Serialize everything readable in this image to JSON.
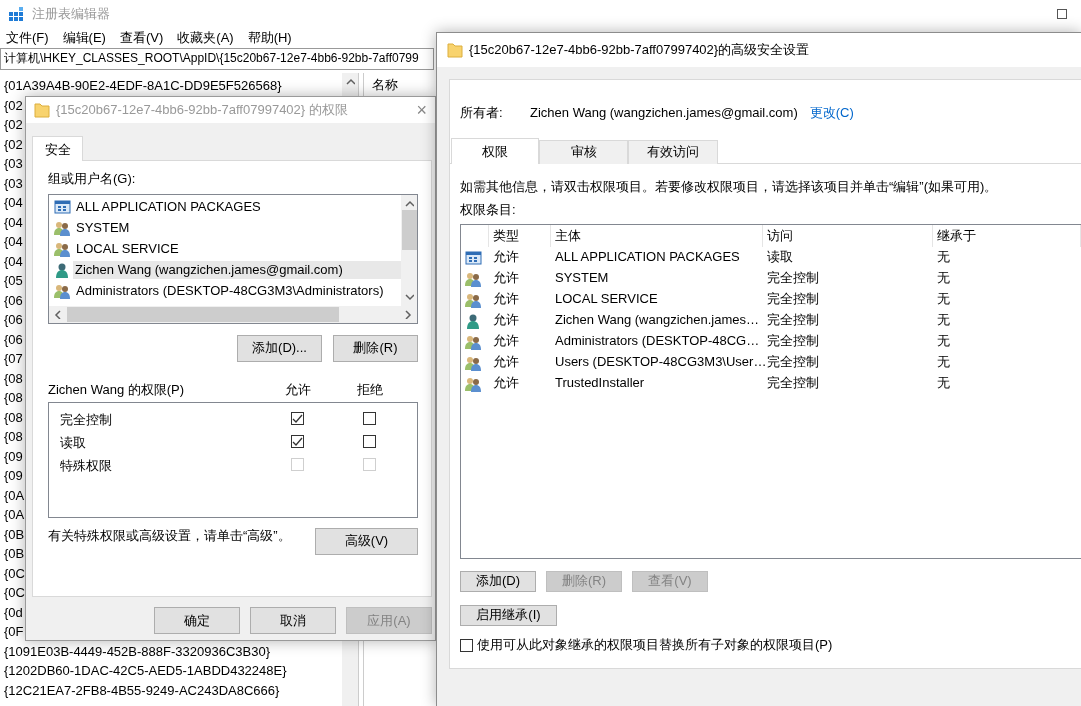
{
  "registry_editor": {
    "title": "注册表编辑器",
    "menu": [
      "文件(F)",
      "编辑(E)",
      "查看(V)",
      "收藏夹(A)",
      "帮助(H)"
    ],
    "address": "计算机\\HKEY_CLASSES_ROOT\\AppID\\{15c20b67-12e7-4bb6-92bb-7aff0799",
    "tree_items": [
      "{01A39A4B-90E2-4EDF-8A1C-DD9E5F526568}",
      "{02",
      "{02",
      "{02",
      "{03",
      "{03",
      "{04",
      "{04",
      "{04",
      "{04",
      "{05",
      "{06",
      "{06",
      "{06",
      "{07",
      "{08",
      "{08",
      "{08",
      "{08",
      "{09",
      "{09",
      "{0A",
      "{0A",
      "{0B",
      "{0B",
      "{0C",
      "{0C",
      "{0d",
      "{0F",
      "{1091E03B-4449-452B-888F-3320936C3B30}",
      "{1202DB60-1DAC-42C5-AED5-1ABDD432248E}",
      "{12C21EA7-2FB8-4B55-9249-AC243DA8C666}"
    ],
    "column_header": "名称"
  },
  "permissions_dialog": {
    "title": "{15c20b67-12e7-4bb6-92bb-7aff07997402} 的权限",
    "close_glyph": "×",
    "tabs": [
      {
        "label": "安全",
        "selected": true
      }
    ],
    "group_label": "组或用户名(G):",
    "principals": [
      {
        "kind": "package",
        "name": "ALL APPLICATION PACKAGES",
        "selected": false
      },
      {
        "kind": "group",
        "name": "SYSTEM",
        "selected": false
      },
      {
        "kind": "group",
        "name": "LOCAL SERVICE",
        "selected": false
      },
      {
        "kind": "user",
        "name": "Zichen Wang (wangzichen.james@gmail.com)",
        "selected": true
      },
      {
        "kind": "group",
        "name": "Administrators (DESKTOP-48CG3M3\\Administrators)",
        "selected": false
      }
    ],
    "list_buttons": [
      "添加(D)...",
      "删除(R)"
    ],
    "permissions_label": "Zichen Wang 的权限(P)",
    "allow_header": "允许",
    "deny_header": "拒绝",
    "permissions": [
      {
        "name": "完全控制",
        "allow": true,
        "deny": false,
        "disabled": false
      },
      {
        "name": "读取",
        "allow": true,
        "deny": false,
        "disabled": false
      },
      {
        "name": "特殊权限",
        "allow": false,
        "deny": false,
        "disabled": true
      }
    ],
    "advanced_hint": "有关特殊权限或高级设置，请单击“高级”。",
    "advanced_button": "高级(V)",
    "footer_buttons": [
      {
        "label": "确定",
        "disabled": false
      },
      {
        "label": "取消",
        "disabled": false
      },
      {
        "label": "应用(A)",
        "disabled": true
      }
    ]
  },
  "advanced_dialog": {
    "title": "{15c20b67-12e7-4bb6-92bb-7aff07997402}的高级安全设置",
    "owner_label": "所有者:",
    "owner": "Zichen Wang (wangzichen.james@gmail.com)",
    "change_link": "更改(C)",
    "tabs": [
      {
        "label": "权限",
        "selected": true
      },
      {
        "label": "审核",
        "selected": false
      },
      {
        "label": "有效访问",
        "selected": false
      }
    ],
    "info": "如需其他信息，请双击权限项目。若要修改权限项目，请选择该项目并单击“编辑”(如果可用)。",
    "entries_label": "权限条目:",
    "columns": [
      "类型",
      "主体",
      "访问",
      "继承于"
    ],
    "entries": [
      {
        "kind": "package",
        "type": "允许",
        "principal": "ALL APPLICATION PACKAGES",
        "access": "读取",
        "inherited_from": "无"
      },
      {
        "kind": "group",
        "type": "允许",
        "principal": "SYSTEM",
        "access": "完全控制",
        "inherited_from": "无"
      },
      {
        "kind": "group",
        "type": "允许",
        "principal": "LOCAL SERVICE",
        "access": "完全控制",
        "inherited_from": "无"
      },
      {
        "kind": "user",
        "type": "允许",
        "principal": "Zichen Wang (wangzichen.james…",
        "access": "完全控制",
        "inherited_from": "无"
      },
      {
        "kind": "group",
        "type": "允许",
        "principal": "Administrators (DESKTOP-48CG…",
        "access": "完全控制",
        "inherited_from": "无"
      },
      {
        "kind": "group",
        "type": "允许",
        "principal": "Users (DESKTOP-48CG3M3\\User…",
        "access": "完全控制",
        "inherited_from": "无"
      },
      {
        "kind": "group",
        "type": "允许",
        "principal": "TrustedInstaller",
        "access": "完全控制",
        "inherited_from": "无"
      }
    ],
    "entry_buttons": [
      {
        "label": "添加(D)",
        "disabled": false
      },
      {
        "label": "删除(R)",
        "disabled": true
      },
      {
        "label": "查看(V)",
        "disabled": true
      }
    ],
    "inherit_button": "启用继承(I)",
    "replace_option": {
      "label": "使用可从此对象继承的权限项目替换所有子对象的权限项目(P)",
      "checked": false
    }
  }
}
